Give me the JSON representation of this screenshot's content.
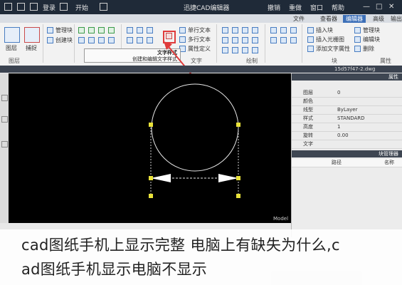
{
  "titlebar": {
    "app_title": "迅捷CAD编辑器",
    "left_items": [
      "登录",
      "开始"
    ],
    "right_items": [
      "撤销",
      "重做",
      "窗口",
      "帮助"
    ]
  },
  "tabs": [
    "文件",
    "查看器",
    "编辑器",
    "高级",
    "输出"
  ],
  "active_tab": "编辑器",
  "ribbon": {
    "items": [
      "单行文本",
      "多行文本",
      "属性定义",
      "文字样式",
      "插入块",
      "插入光栅图",
      "创建块",
      "编辑块",
      "管理块",
      "插入",
      "删除",
      "添加文字属性"
    ],
    "groups": [
      "图层",
      "文字",
      "绘制",
      "块",
      "属性"
    ],
    "left_buttons": [
      "图层",
      "捕捉"
    ]
  },
  "tooltip": {
    "title": "文字样式",
    "body": "创建和编辑文字样式"
  },
  "file_tab": "15d57f47-2.dwg",
  "canvas": {
    "layout_tab": "Model"
  },
  "properties": {
    "header": "属性",
    "rows": [
      {
        "key": "图层",
        "value": "0"
      },
      {
        "key": "颜色",
        "value": ""
      },
      {
        "key": "线型",
        "value": "ByLayer"
      },
      {
        "key": "样式",
        "value": "STANDARD"
      },
      {
        "key": "高度",
        "value": "1"
      },
      {
        "key": "旋转",
        "value": "0.00"
      },
      {
        "key": "文字",
        "value": ""
      }
    ],
    "section2": "块管理器",
    "section2_cols": [
      "名称",
      "路径"
    ]
  },
  "caption": {
    "line1": "cad图纸手机上显示完整 电脑上有缺失为什么,c",
    "line2": "ad图纸手机显示电脑不显示"
  },
  "colors": {
    "accent": "#3c6fb8",
    "highlight": "#e03b3b",
    "canvas_bg": "#000000"
  }
}
